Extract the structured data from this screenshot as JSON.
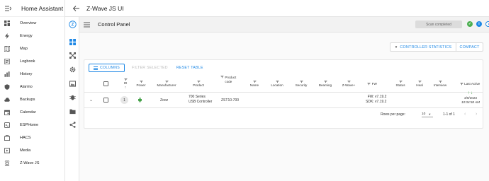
{
  "sidebar": {
    "title": "Home Assistant",
    "items": [
      {
        "label": "Overview",
        "icon": "overview-icon"
      },
      {
        "label": "Energy",
        "icon": "energy-icon"
      },
      {
        "label": "Map",
        "icon": "map-icon"
      },
      {
        "label": "Logbook",
        "icon": "logbook-icon"
      },
      {
        "label": "History",
        "icon": "history-icon"
      },
      {
        "label": "Alarmo",
        "icon": "alarmo-icon"
      },
      {
        "label": "Backups",
        "icon": "backups-icon"
      },
      {
        "label": "Calendar",
        "icon": "calendar-icon"
      },
      {
        "label": "ESPHome",
        "icon": "esphome-icon"
      },
      {
        "label": "HACS",
        "icon": "hacs-icon"
      },
      {
        "label": "Media",
        "icon": "media-icon"
      },
      {
        "label": "Z-Wave JS",
        "icon": "zwave-icon"
      }
    ]
  },
  "app": {
    "title": "Z-Wave JS UI",
    "logo_letter": "Z",
    "rail_icons": [
      "control-panel-icon",
      "network-graph-icon",
      "settings-icon",
      "scenes-icon",
      "debug-icon",
      "store-icon",
      "share-icon"
    ]
  },
  "control_panel": {
    "title": "Control Panel",
    "scan_status": "Scan completed"
  },
  "buttons": {
    "controller_statistics": "CONTROLLER STATISTICS",
    "compact": "COMPACT"
  },
  "toolbar": {
    "columns": "COLUMNS",
    "filter_selected": "FILTER SELECTED",
    "reset_table": "RESET TABLE"
  },
  "table": {
    "headers": {
      "id": "ID",
      "power": "Power",
      "manufacturer": "Manufacturer",
      "product": "Product",
      "product_code": "Product code",
      "name": "Name",
      "location": "Location",
      "security": "Security",
      "beaming": "Beaming",
      "zwave_plus": "Z-Wave+",
      "fw": "FW",
      "status": "Status",
      "heal": "Heal",
      "interview": "Interview",
      "last_active": "Last Active"
    },
    "rows": [
      {
        "id": "1",
        "manufacturer": "Zooz",
        "product_line1": "700 Series",
        "product_line2": "USB Controller",
        "product_code": "ZST10-700",
        "fw": "FW: v7.19.2",
        "sdk": "SDK: v7.19.2",
        "last_active_date": "3/9/2023",
        "last_active_time": "10:34:58 AM"
      }
    ]
  },
  "pagination": {
    "rows_per_page_label": "Rows per page:",
    "rows_per_page": "10",
    "range": "1-1 of 1"
  },
  "colors": {
    "accent": "#1e88e5",
    "green": "#43a047",
    "status_green": "#4caf50",
    "status_blue": "#1e88e5"
  }
}
